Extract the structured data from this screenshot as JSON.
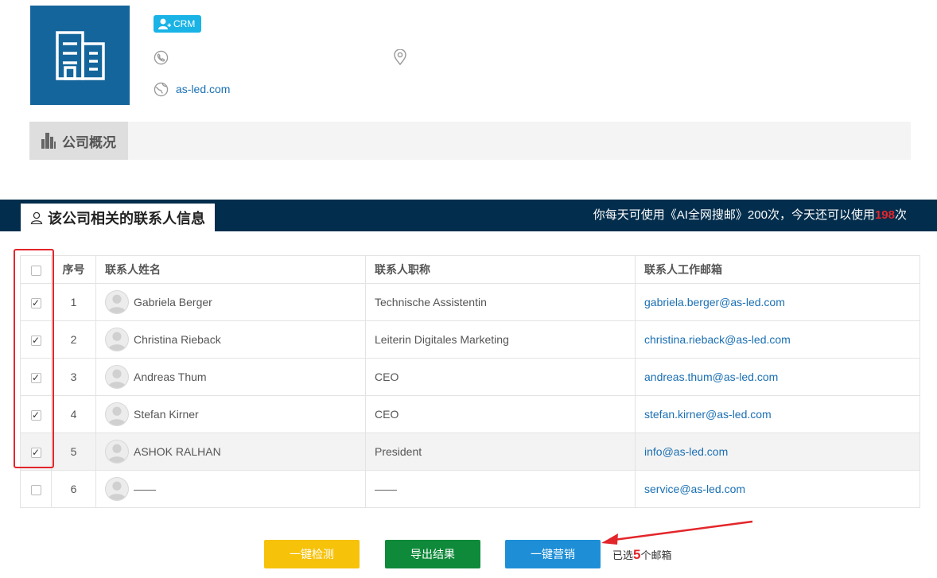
{
  "company": {
    "badge_label": "CRM",
    "website": "as-led.com",
    "overview_tab": "公司概况"
  },
  "contacts": {
    "section_title": "该公司相关的联系人信息",
    "quota_prefix": "你每天可使用《AI全网搜邮》200次，今天还可以使用",
    "quota_remaining": "198",
    "quota_suffix": "次",
    "headers": {
      "index": "序号",
      "name": "联系人姓名",
      "title": "联系人职称",
      "email": "联系人工作邮箱"
    },
    "rows": [
      {
        "index": "1",
        "name": "Gabriela Berger",
        "title": "Technische Assistentin",
        "email": "gabriela.berger@as-led.com",
        "checked": true
      },
      {
        "index": "2",
        "name": "Christina Rieback",
        "title": "Leiterin Digitales Marketing",
        "email": "christina.rieback@as-led.com",
        "checked": true
      },
      {
        "index": "3",
        "name": "Andreas Thum",
        "title": "CEO",
        "email": "andreas.thum@as-led.com",
        "checked": true
      },
      {
        "index": "4",
        "name": "Stefan Kirner",
        "title": "CEO",
        "email": "stefan.kirner@as-led.com",
        "checked": true
      },
      {
        "index": "5",
        "name": "ASHOK RALHAN",
        "title": "President",
        "email": "info@as-led.com",
        "checked": true
      },
      {
        "index": "6",
        "name": "——",
        "title": "——",
        "email": "service@as-led.com",
        "checked": false
      }
    ]
  },
  "actions": {
    "detect_label": "一键检测",
    "export_label": "导出结果",
    "market_label": "一键营销",
    "selected_prefix": "已选",
    "selected_count": "5",
    "selected_suffix": "个邮箱"
  },
  "colors": {
    "brand_blue": "#14659b",
    "banner_navy": "#022d4c",
    "accent_red": "#e3262b",
    "link_blue": "#1a6fb3"
  }
}
